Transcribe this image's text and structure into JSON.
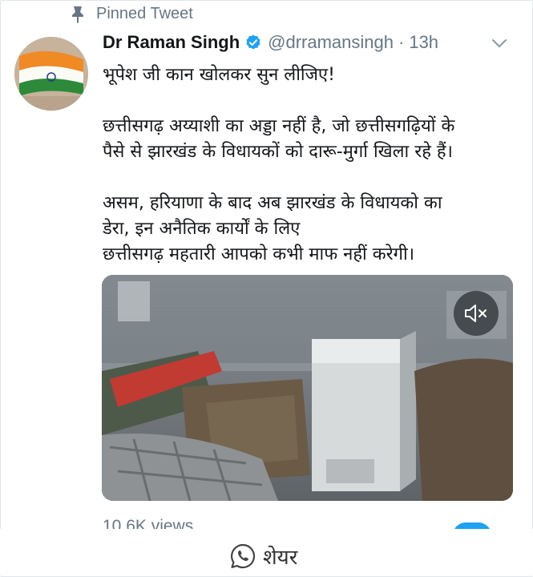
{
  "pinned": {
    "label": "Pinned Tweet"
  },
  "author": {
    "name": "Dr Raman Singh",
    "handle": "@drramansingh",
    "separator": "·",
    "time": "13h"
  },
  "tweet": {
    "lines_1": [
      "भूपेश जी कान खोलकर सुन लीजिए!"
    ],
    "lines_2": [
      "छत्तीसगढ़ अय्याशी का अड्डा नहीं है, जो छत्तीसगढ़ियों के",
      "पैसे से झारखंड के विधायकों को दारू-मुर्गा खिला रहे हैं।"
    ],
    "lines_3": [
      "असम, हरियाणा के बाद अब झारखंड के विधायको का",
      "डेरा, इन अनैतिक कार्यों के लिए",
      "छत्तीसगढ़ महतारी आपको कभी माफ नहीं करेगी।"
    ]
  },
  "video": {
    "views": "10.6K views"
  },
  "share": {
    "label": "शेयर"
  },
  "icons": {
    "pin": "pin-icon",
    "verified": "verified-badge-icon",
    "more": "chevron-down-icon",
    "mute": "mute-icon",
    "whatsapp": "whatsapp-icon"
  },
  "colors": {
    "link_blue": "#1da1f2",
    "muted_gray": "#657786"
  }
}
